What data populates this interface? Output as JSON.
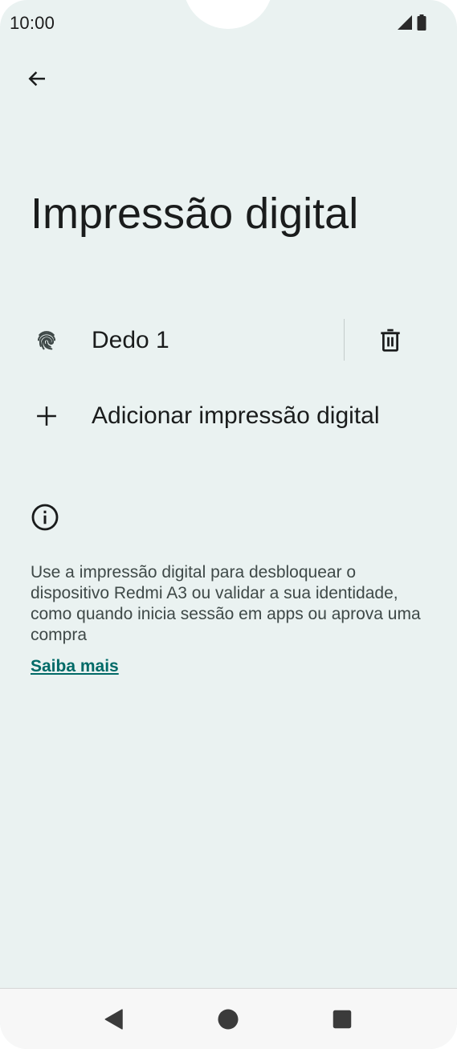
{
  "status_bar": {
    "time": "10:00",
    "signal_icon": "signal-icon",
    "battery_icon": "battery-icon"
  },
  "toolbar": {
    "back_icon": "arrow-left-icon"
  },
  "page": {
    "title": "Impressão digital"
  },
  "fingerprints": [
    {
      "label": "Dedo 1",
      "icon": "fingerprint-icon",
      "delete_icon": "trash-icon"
    }
  ],
  "add_fingerprint": {
    "label": "Adicionar impressão digital",
    "icon": "plus-icon"
  },
  "info": {
    "icon": "info-icon",
    "text": "Use a impressão digital para desbloquear o dispositivo Redmi A3 ou validar a sua identidade, como quando inicia sessão em apps ou aprova uma compra",
    "link": "Saiba mais"
  },
  "nav_bar": {
    "back_icon": "triangle-back-icon",
    "home_icon": "circle-home-icon",
    "recents_icon": "square-recents-icon"
  },
  "colors": {
    "background": "#eaf2f1",
    "text_primary": "#1a1c1c",
    "text_secondary": "#3f4948",
    "link": "#006a67",
    "nav_bar": "#f7f7f7"
  }
}
